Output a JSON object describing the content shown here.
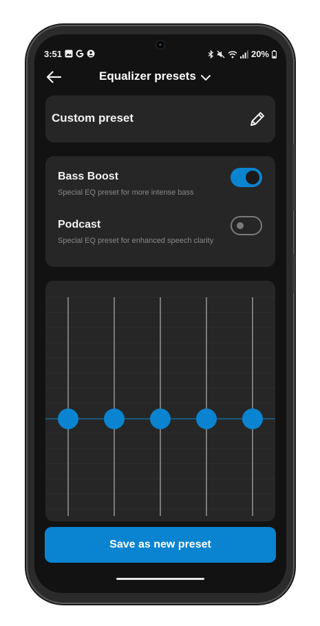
{
  "status_bar": {
    "time": "3:51",
    "left_icons": [
      "image-icon",
      "google-icon",
      "account-icon"
    ],
    "right_icons": [
      "bluetooth-icon",
      "mute-icon",
      "wifi-icon",
      "signal-icon",
      "battery-icon"
    ],
    "battery": "20%"
  },
  "header": {
    "back_icon": "arrow-left-icon",
    "title": "Equalizer presets",
    "dropdown_icon": "chevron-down-icon"
  },
  "custom_preset": {
    "label": "Custom preset",
    "edit_icon": "pencil-icon"
  },
  "presets": [
    {
      "title": "Bass Boost",
      "description": "Special EQ preset for more intense bass",
      "enabled": true
    },
    {
      "title": "Podcast",
      "description": "Special EQ preset for enhanced speech clarity",
      "enabled": false
    }
  ],
  "equalizer": {
    "band_count": 5,
    "band_levels": [
      0,
      0,
      0,
      0,
      0
    ],
    "level_range": [
      -1,
      1
    ]
  },
  "save_button": {
    "label": "Save as new preset"
  },
  "colors": {
    "accent": "#0a84d0",
    "background": "#121212",
    "card": "#262626",
    "text_primary": "#f2f2f2",
    "text_secondary": "#8a8a8a"
  }
}
